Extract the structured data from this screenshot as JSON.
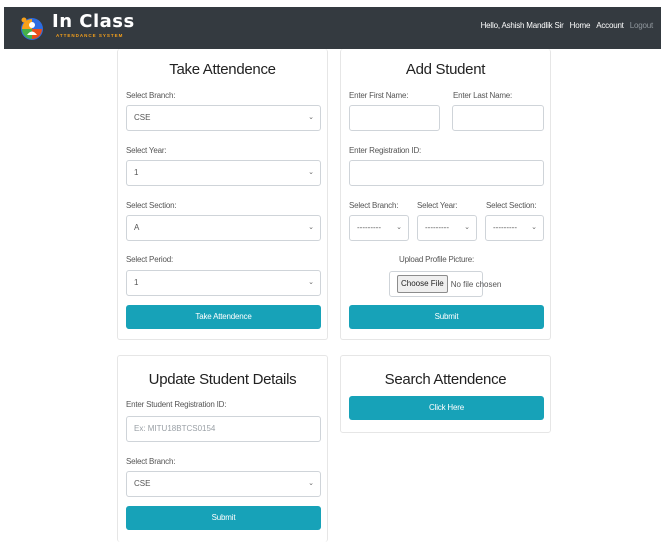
{
  "brand": {
    "name": "In Class",
    "tagline": "ATTENDANCE SYSTEM"
  },
  "nav": {
    "greeting": "Hello, Ashish Mandlik Sir",
    "home": "Home",
    "account": "Account",
    "logout": "Logout"
  },
  "take_attendance": {
    "title": "Take Attendence",
    "branch_label": "Select Branch:",
    "branch_value": "CSE",
    "year_label": "Select Year:",
    "year_value": "1",
    "section_label": "Select Section:",
    "section_value": "A",
    "period_label": "Select Period:",
    "period_value": "1",
    "submit_label": "Take Attendence"
  },
  "add_student": {
    "title": "Add Student",
    "first_name_label": "Enter First Name:",
    "last_name_label": "Enter Last Name:",
    "reg_id_label": "Enter Registration ID:",
    "branch_label": "Select Branch:",
    "branch_value": "---------",
    "year_label": "Select Year:",
    "year_value": "---------",
    "section_label": "Select Section:",
    "section_value": "---------",
    "upload_label": "Upload Profile Picture:",
    "choose_file": "Choose File",
    "no_file": "No file chosen",
    "submit_label": "Submit"
  },
  "update_student": {
    "title": "Update Student Details",
    "reg_id_label": "Enter Student Registration ID:",
    "reg_id_placeholder": "Ex: MITU18BTCS0154",
    "branch_label": "Select Branch:",
    "branch_value": "CSE",
    "submit_label": "Submit"
  },
  "search_attendance": {
    "title": "Search Attendence",
    "button_label": "Click Here"
  },
  "colors": {
    "navbar": "#343a40",
    "accent": "#17a2b8",
    "brand_sub": "#f7a11a"
  }
}
